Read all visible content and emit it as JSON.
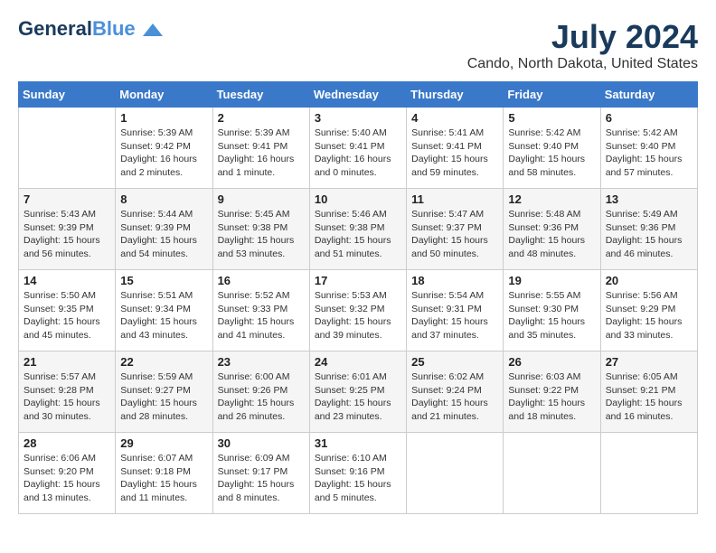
{
  "logo": {
    "line1": "General",
    "line2": "Blue"
  },
  "title": "July 2024",
  "location": "Cando, North Dakota, United States",
  "days_of_week": [
    "Sunday",
    "Monday",
    "Tuesday",
    "Wednesday",
    "Thursday",
    "Friday",
    "Saturday"
  ],
  "weeks": [
    [
      {
        "day": "",
        "info": ""
      },
      {
        "day": "1",
        "info": "Sunrise: 5:39 AM\nSunset: 9:42 PM\nDaylight: 16 hours\nand 2 minutes."
      },
      {
        "day": "2",
        "info": "Sunrise: 5:39 AM\nSunset: 9:41 PM\nDaylight: 16 hours\nand 1 minute."
      },
      {
        "day": "3",
        "info": "Sunrise: 5:40 AM\nSunset: 9:41 PM\nDaylight: 16 hours\nand 0 minutes."
      },
      {
        "day": "4",
        "info": "Sunrise: 5:41 AM\nSunset: 9:41 PM\nDaylight: 15 hours\nand 59 minutes."
      },
      {
        "day": "5",
        "info": "Sunrise: 5:42 AM\nSunset: 9:40 PM\nDaylight: 15 hours\nand 58 minutes."
      },
      {
        "day": "6",
        "info": "Sunrise: 5:42 AM\nSunset: 9:40 PM\nDaylight: 15 hours\nand 57 minutes."
      }
    ],
    [
      {
        "day": "7",
        "info": "Sunrise: 5:43 AM\nSunset: 9:39 PM\nDaylight: 15 hours\nand 56 minutes."
      },
      {
        "day": "8",
        "info": "Sunrise: 5:44 AM\nSunset: 9:39 PM\nDaylight: 15 hours\nand 54 minutes."
      },
      {
        "day": "9",
        "info": "Sunrise: 5:45 AM\nSunset: 9:38 PM\nDaylight: 15 hours\nand 53 minutes."
      },
      {
        "day": "10",
        "info": "Sunrise: 5:46 AM\nSunset: 9:38 PM\nDaylight: 15 hours\nand 51 minutes."
      },
      {
        "day": "11",
        "info": "Sunrise: 5:47 AM\nSunset: 9:37 PM\nDaylight: 15 hours\nand 50 minutes."
      },
      {
        "day": "12",
        "info": "Sunrise: 5:48 AM\nSunset: 9:36 PM\nDaylight: 15 hours\nand 48 minutes."
      },
      {
        "day": "13",
        "info": "Sunrise: 5:49 AM\nSunset: 9:36 PM\nDaylight: 15 hours\nand 46 minutes."
      }
    ],
    [
      {
        "day": "14",
        "info": "Sunrise: 5:50 AM\nSunset: 9:35 PM\nDaylight: 15 hours\nand 45 minutes."
      },
      {
        "day": "15",
        "info": "Sunrise: 5:51 AM\nSunset: 9:34 PM\nDaylight: 15 hours\nand 43 minutes."
      },
      {
        "day": "16",
        "info": "Sunrise: 5:52 AM\nSunset: 9:33 PM\nDaylight: 15 hours\nand 41 minutes."
      },
      {
        "day": "17",
        "info": "Sunrise: 5:53 AM\nSunset: 9:32 PM\nDaylight: 15 hours\nand 39 minutes."
      },
      {
        "day": "18",
        "info": "Sunrise: 5:54 AM\nSunset: 9:31 PM\nDaylight: 15 hours\nand 37 minutes."
      },
      {
        "day": "19",
        "info": "Sunrise: 5:55 AM\nSunset: 9:30 PM\nDaylight: 15 hours\nand 35 minutes."
      },
      {
        "day": "20",
        "info": "Sunrise: 5:56 AM\nSunset: 9:29 PM\nDaylight: 15 hours\nand 33 minutes."
      }
    ],
    [
      {
        "day": "21",
        "info": "Sunrise: 5:57 AM\nSunset: 9:28 PM\nDaylight: 15 hours\nand 30 minutes."
      },
      {
        "day": "22",
        "info": "Sunrise: 5:59 AM\nSunset: 9:27 PM\nDaylight: 15 hours\nand 28 minutes."
      },
      {
        "day": "23",
        "info": "Sunrise: 6:00 AM\nSunset: 9:26 PM\nDaylight: 15 hours\nand 26 minutes."
      },
      {
        "day": "24",
        "info": "Sunrise: 6:01 AM\nSunset: 9:25 PM\nDaylight: 15 hours\nand 23 minutes."
      },
      {
        "day": "25",
        "info": "Sunrise: 6:02 AM\nSunset: 9:24 PM\nDaylight: 15 hours\nand 21 minutes."
      },
      {
        "day": "26",
        "info": "Sunrise: 6:03 AM\nSunset: 9:22 PM\nDaylight: 15 hours\nand 18 minutes."
      },
      {
        "day": "27",
        "info": "Sunrise: 6:05 AM\nSunset: 9:21 PM\nDaylight: 15 hours\nand 16 minutes."
      }
    ],
    [
      {
        "day": "28",
        "info": "Sunrise: 6:06 AM\nSunset: 9:20 PM\nDaylight: 15 hours\nand 13 minutes."
      },
      {
        "day": "29",
        "info": "Sunrise: 6:07 AM\nSunset: 9:18 PM\nDaylight: 15 hours\nand 11 minutes."
      },
      {
        "day": "30",
        "info": "Sunrise: 6:09 AM\nSunset: 9:17 PM\nDaylight: 15 hours\nand 8 minutes."
      },
      {
        "day": "31",
        "info": "Sunrise: 6:10 AM\nSunset: 9:16 PM\nDaylight: 15 hours\nand 5 minutes."
      },
      {
        "day": "",
        "info": ""
      },
      {
        "day": "",
        "info": ""
      },
      {
        "day": "",
        "info": ""
      }
    ]
  ]
}
